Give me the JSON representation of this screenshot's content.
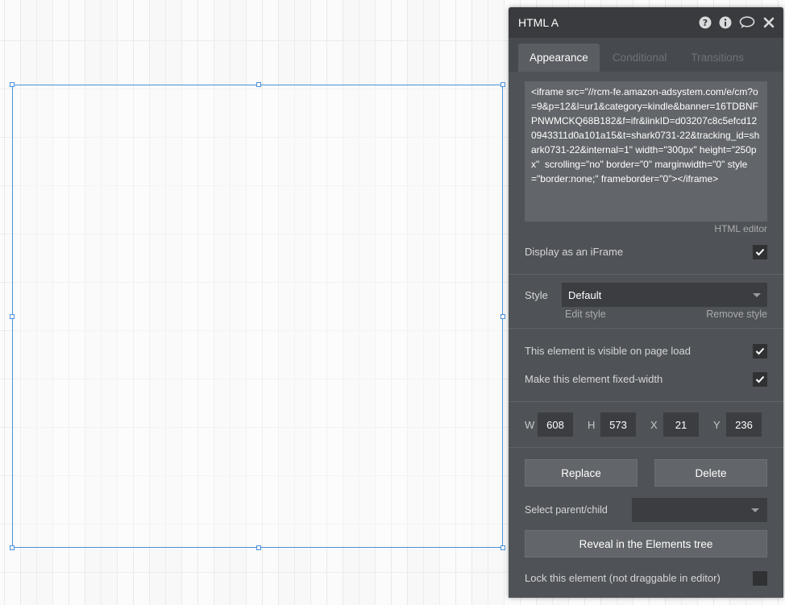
{
  "panel": {
    "title": "HTML A",
    "icons": [
      "help-icon",
      "info-icon",
      "comment-icon",
      "close-icon"
    ]
  },
  "tabs": [
    {
      "label": "Appearance",
      "active": true
    },
    {
      "label": "Conditional",
      "active": false
    },
    {
      "label": "Transitions",
      "active": false
    }
  ],
  "html_editor": {
    "content": "<iframe src=\"//rcm-fe.amazon-adsystem.com/e/cm?o=9&p=12&l=ur1&category=kindle&banner=16TDBNFPNWMCKQ68B182&f=ifr&linkID=d03207c8c5efcd120943311d0a101a15&t=shark0731-22&tracking_id=shark0731-22&internal=1\" width=\"300px\" height=\"250px\"  scrolling=\"no\" border=\"0\" marginwidth=\"0\" style=\"border:none;\" frameborder=\"0\"></iframe>",
    "link": "HTML editor"
  },
  "display_iframe": {
    "label": "Display as an iFrame",
    "checked": true
  },
  "style": {
    "label": "Style",
    "value": "Default",
    "edit_link": "Edit style",
    "remove_link": "Remove style"
  },
  "visible_on_load": {
    "label": "This element is visible on page load",
    "checked": true
  },
  "fixed_width": {
    "label": "Make this element fixed-width",
    "checked": true
  },
  "dimensions": {
    "w_label": "W",
    "w": "608",
    "h_label": "H",
    "h": "573",
    "x_label": "X",
    "x": "21",
    "y_label": "Y",
    "y": "236"
  },
  "buttons": {
    "replace": "Replace",
    "delete": "Delete",
    "reveal": "Reveal in the Elements tree"
  },
  "parent_child": {
    "label": "Select parent/child",
    "value": ""
  },
  "lock": {
    "label": "Lock this element (not draggable in editor)",
    "checked": false
  },
  "colors": {
    "panel_bg": "#4f5256",
    "header_bg": "#393b3e",
    "selection_border": "#4a90d9"
  }
}
